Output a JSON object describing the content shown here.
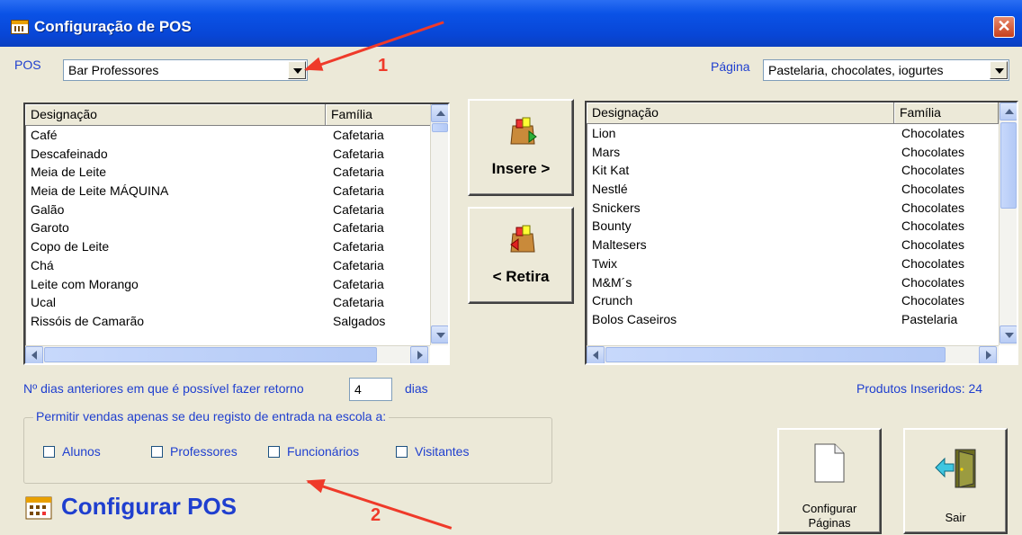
{
  "window": {
    "title": "Configuração de POS",
    "close_label": "✕"
  },
  "pos": {
    "label": "POS",
    "value": "Bar Professores"
  },
  "pagina": {
    "label": "Página",
    "value": "Pastelaria, chocolates, iogurtes"
  },
  "left_list": {
    "columns": [
      "Designação",
      "Família"
    ],
    "rows": [
      [
        "Café",
        "Cafetaria"
      ],
      [
        "Descafeinado",
        "Cafetaria"
      ],
      [
        "Meia de Leite",
        "Cafetaria"
      ],
      [
        "Meia de Leite MÁQUINA",
        "Cafetaria"
      ],
      [
        "Galão",
        "Cafetaria"
      ],
      [
        "Garoto",
        "Cafetaria"
      ],
      [
        "Copo de Leite",
        "Cafetaria"
      ],
      [
        "Chá",
        "Cafetaria"
      ],
      [
        "Leite com Morango",
        "Cafetaria"
      ],
      [
        "Ucal",
        "Cafetaria"
      ],
      [
        "Rissóis de Camarão",
        "Salgados"
      ]
    ]
  },
  "right_list": {
    "columns": [
      "Designação",
      "Família"
    ],
    "rows": [
      [
        "Lion",
        "Chocolates"
      ],
      [
        "Mars",
        "Chocolates"
      ],
      [
        "Kit Kat",
        "Chocolates"
      ],
      [
        "Nestlé",
        "Chocolates"
      ],
      [
        "Snickers",
        "Chocolates"
      ],
      [
        "Bounty",
        "Chocolates"
      ],
      [
        "Maltesers",
        "Chocolates"
      ],
      [
        "Twix",
        "Chocolates"
      ],
      [
        "M&M´s",
        "Chocolates"
      ],
      [
        "Crunch",
        "Chocolates"
      ],
      [
        "Bolos Caseiros",
        "Pastelaria"
      ]
    ]
  },
  "buttons": {
    "insere": "Insere >",
    "retira": "< Retira",
    "configurar_paginas": [
      "Configurar",
      "Páginas"
    ],
    "sair": "Sair"
  },
  "dias": {
    "label": "Nº dias anteriores em que é possível fazer retorno",
    "value": "4",
    "suffix": "dias"
  },
  "produtos_inseridos": "Produtos Inseridos: 24",
  "group": {
    "legend": "Permitir vendas apenas se deu registo de entrada na escola a:",
    "options": [
      "Alunos",
      "Professores",
      "Funcionários",
      "Visitantes"
    ]
  },
  "footer_title": "Configurar POS",
  "annotations": {
    "one": "1",
    "two": "2"
  },
  "colors": {
    "title_blue": "#0a52e6",
    "label_blue": "#1f3fcf",
    "arrow_red": "#ef3a2a",
    "window_bg": "#ece9d8"
  }
}
